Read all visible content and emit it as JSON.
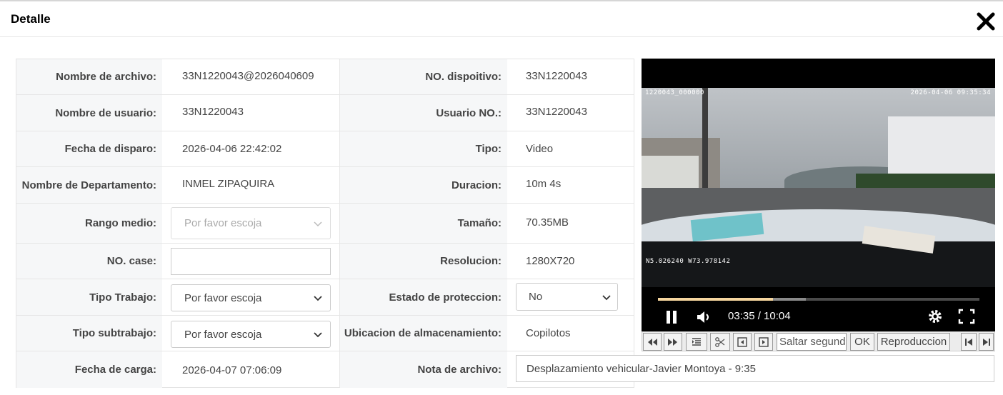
{
  "modal": {
    "title": "Detalle",
    "close_icon": "close-icon"
  },
  "rows": [
    {
      "label1": "Nombre de archivo:",
      "value1": "33N1220043@2026040609",
      "label2": "NO. dispoitivo:",
      "value2": "33N1220043"
    },
    {
      "label1": "Nombre de usuario:",
      "value1": "33N1220043",
      "label2": "Usuario NO.:",
      "value2": "33N1220043"
    },
    {
      "label1": "Fecha de disparo:",
      "value1": "2026-04-06 22:42:02",
      "label2": "Tipo:",
      "value2": "Video"
    },
    {
      "label1": "Nombre de Departamento:",
      "value1": "INMEL ZIPAQUIRA",
      "label2": "Duracion:",
      "value2": "10m 4s"
    },
    {
      "label1": "Rango medio:",
      "value1_placeholder": "Por favor escoja",
      "label2": "Tamaño:",
      "value2": "70.35MB"
    },
    {
      "label1": "NO. case:",
      "value1": "",
      "label2": "Resolucion:",
      "value2": "1280X720"
    },
    {
      "label1": "Tipo Trabajo:",
      "value1_selected": "Por favor escoja",
      "label2": "Estado de proteccion:",
      "value2_selected": "No"
    },
    {
      "label1": "Tipo subtrabajo:",
      "value1_selected": "Por favor escoja",
      "label2": "Ubicacion de almacenamiento:",
      "value2": "Copilotos"
    },
    {
      "label1": "Fecha de carga:",
      "value1": "2026-04-07 07:06:09",
      "label2": "Nota de archivo:",
      "value2": "Desplazamiento vehicular-Javier Montoya - 9:35"
    }
  ],
  "video": {
    "osd_top_left": "1220043_000000",
    "osd_top_right": "2026-04-06 09:35:34",
    "osd_bottom_left": "N5.026240  W73.978142",
    "time_display": "03:35 / 10:04",
    "progress_played": 0.358,
    "progress_buffered": 0.46
  },
  "toolbar": {
    "seek_placeholder": "Saltar segundos",
    "ok_label": "OK",
    "playback_label": "Reproduccion"
  },
  "colors": {
    "progress_played": "#f5d59e",
    "label_bg": "#f6f7f8"
  }
}
